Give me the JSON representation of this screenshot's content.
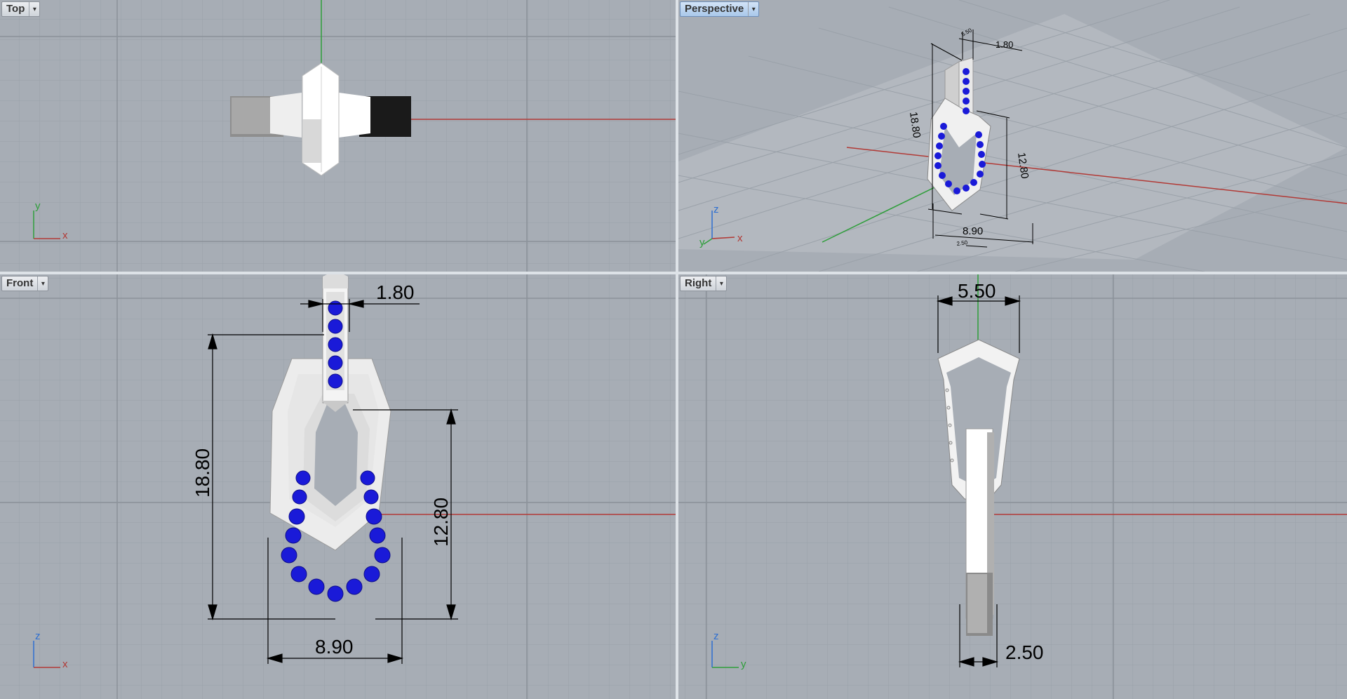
{
  "viewports": {
    "top": {
      "title": "Top",
      "axis_x": "x",
      "axis_y": "y"
    },
    "perspective": {
      "title": "Perspective",
      "axis_x": "x",
      "axis_y": "y",
      "axis_z": "z",
      "dims": {
        "height": "18.80",
        "inner_height": "12.80",
        "width": "8.90",
        "bail_width": "1.80",
        "small_a": "5.50",
        "small_b": "2.50"
      }
    },
    "front": {
      "title": "Front",
      "axis_x": "x",
      "axis_z": "z",
      "dims": {
        "bail_width": "1.80",
        "height": "18.80",
        "inner_height": "12.80",
        "width": "8.90"
      }
    },
    "right": {
      "title": "Right",
      "axis_y": "y",
      "axis_z": "z",
      "dims": {
        "depth": "5.50",
        "thickness": "2.50"
      }
    }
  },
  "colors": {
    "viewport_bg": "#a7adb5",
    "grid_minor": "#9aa1a9",
    "grid_major": "#8a9199",
    "x_axis": "#b23a36",
    "y_axis": "#2e9e3a",
    "gem": "#1a1ad8",
    "metal": "#f2f2f2",
    "active_tab": "#a9c8ea"
  },
  "icons": {
    "viewport_menu": "chevron-down-icon"
  }
}
